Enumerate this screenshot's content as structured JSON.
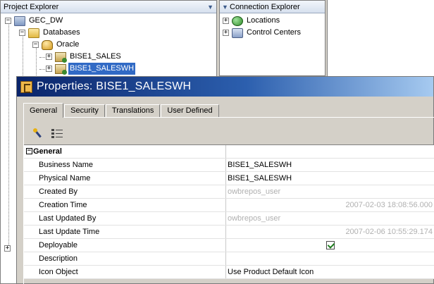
{
  "project_explorer": {
    "title": "Project Explorer",
    "tree": [
      {
        "label": "GEC_DW",
        "icon": "project-icon",
        "expander": "−"
      },
      {
        "label": "Databases",
        "icon": "folder-icon",
        "expander": "−"
      },
      {
        "label": "Oracle",
        "icon": "database-icon",
        "expander": "−"
      },
      {
        "label": "BISE1_SALES",
        "icon": "module-icon",
        "expander": "+"
      },
      {
        "label": "BISE1_SALESWH",
        "icon": "module-icon",
        "expander": "+",
        "selected": true
      }
    ],
    "collapsed_expander": "+"
  },
  "connection_explorer": {
    "title": "Connection Explorer",
    "tree": [
      {
        "label": "Locations",
        "icon": "location-icon",
        "expander": "+"
      },
      {
        "label": "Control Centers",
        "icon": "control-center-icon",
        "expander": "+"
      }
    ]
  },
  "properties": {
    "title": "Properties: BISE1_SALESWH",
    "tabs": [
      {
        "label": "General",
        "active": true
      },
      {
        "label": "Security",
        "active": false
      },
      {
        "label": "Translations",
        "active": false
      },
      {
        "label": "User Defined",
        "active": false
      }
    ],
    "section": {
      "label": "General",
      "toggle": "−"
    },
    "rows": [
      {
        "name": "Business Name",
        "value": "BISE1_SALESWH",
        "style": "normal"
      },
      {
        "name": "Physical Name",
        "value": "BISE1_SALESWH",
        "style": "normal"
      },
      {
        "name": "Created By",
        "value": "owbrepos_user",
        "style": "muted"
      },
      {
        "name": "Creation Time",
        "value": "2007-02-03 18:08:56.000",
        "style": "muted-right"
      },
      {
        "name": "Last Updated By",
        "value": "owbrepos_user",
        "style": "muted"
      },
      {
        "name": "Last Update Time",
        "value": "2007-02-06 10:55:29.174",
        "style": "muted-right"
      },
      {
        "name": "Deployable",
        "value": "",
        "style": "checkbox",
        "checked": true
      },
      {
        "name": "Description",
        "value": "",
        "style": "normal"
      },
      {
        "name": "Icon Object",
        "value": "Use Product Default Icon",
        "style": "normal"
      }
    ]
  },
  "colors": {
    "selection": "#316ac5",
    "titlebar_start": "#0a246a",
    "titlebar_end": "#a6caf0",
    "muted_text": "#b0b0b0",
    "check": "#1e7d1e"
  }
}
